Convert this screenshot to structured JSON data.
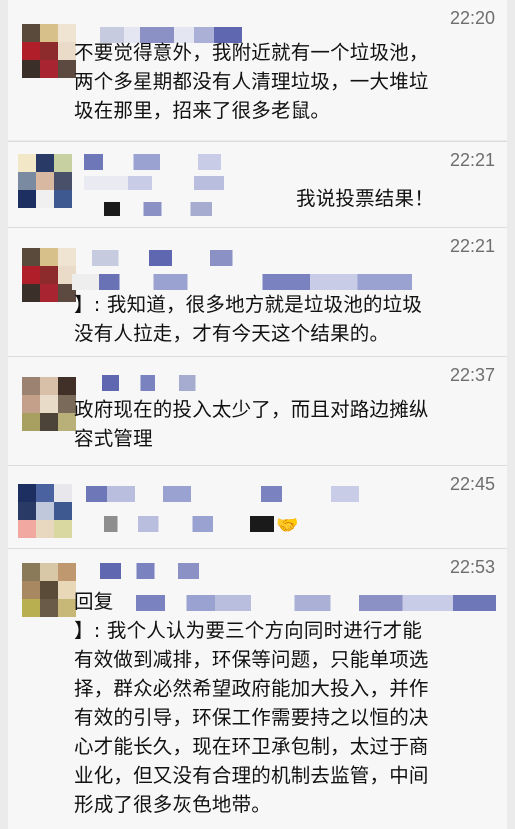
{
  "comments": [
    {
      "time": "22:20",
      "lines": [
        "不要觉得意外，我附近就有一个垃圾池，",
        "两个多星期都没有人清理垃圾，一大堆垃",
        "圾在那里，招来了很多老鼠。"
      ]
    },
    {
      "time": "22:21",
      "lines": [
        "我说投票结果！"
      ]
    },
    {
      "time": "22:21",
      "lines": [
        "】: 我知道，很多地方就是垃圾池的垃圾",
        "没有人拉走，才有今天这个结果的。"
      ]
    },
    {
      "time": "22:37",
      "lines": [
        "政府现在的投入太少了，而且对路边摊纵",
        "容式管理"
      ]
    },
    {
      "time": "22:45",
      "lines": [],
      "emoji_icon": "handshake-icon"
    },
    {
      "time": "22:53",
      "reply_prefix": "回复",
      "lines": [
        "】: 我个人认为要三个方向同时进行才能",
        "有效做到减排，环保等问题，只能单项选",
        "择，群众必然希望政府能加大投入，并作",
        "有效的引导，环保工作需要持之以恒的决",
        "心才能长久，现在环卫承包制，太过于商",
        "业化，但又没有合理的机制去监管，中间",
        "形成了很多灰色地带。"
      ]
    }
  ]
}
